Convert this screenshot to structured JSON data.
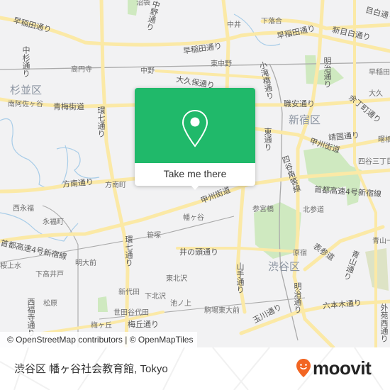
{
  "map": {
    "popup": {
      "cta_label": "Take me there",
      "accent_color": "#20b96a"
    },
    "attribution": "© OpenStreetMap contributors | © OpenMapTiles",
    "labels": {
      "wards": [
        "杉並区",
        "新宿区",
        "渋谷区"
      ],
      "roads": {
        "waseda_w": "早稲田通り",
        "waseda_c": "早稲田通り",
        "waseda_e": "早稲田通り",
        "shinmejiro": "新目白通り",
        "mejiro": "目白通り",
        "nakasugi": "中杉通り",
        "ome": "青梅街道",
        "kan7_n": "環七通り",
        "hounan": "方南通り",
        "koshu_w": "甲州街道",
        "koshu_e": "甲州街道",
        "okubo": "大久保通り",
        "kotakibashi": "小滝橋通り",
        "shokuan": "職安通り",
        "higashi": "東通り",
        "yotsuya_kaido": "四谷角筈線",
        "yasukuni": "靖国通り",
        "yocho": "余丁町通り",
        "meiji_n": "明治通り",
        "meiji_s": "明治通り",
        "shuto4": "首都高速4号新宿線",
        "shuto4_e": "首都高速4号新宿線",
        "kan7_s": "環七通り",
        "inokashira": "井の頭通り",
        "yamate": "山手通り",
        "omotesando": "表参道",
        "aoyama": "青山通り",
        "roppongi": "六本木通り",
        "tamagawa": "玉川通り",
        "umegaoka": "梅丘通り",
        "nishifukuji": "西福寺通り",
        "gaien": "外苑西通り",
        "nakano_dori": "中野通り"
      },
      "places": {
        "numabukuro": "沼袋",
        "nakai": "中井",
        "shimoochiai": "下落合",
        "waseda": "早稲田",
        "koenji": "高円寺",
        "nakano": "中野",
        "higashinakano": "東中野",
        "minamiasagaya": "南阿佐ヶ谷",
        "okubo": "大久",
        "akebonobashi": "曙橋",
        "yotsuya3": "四谷三丁目",
        "honancho": "方南町",
        "nishieifuku": "西永福",
        "eifukucho": "永福町",
        "sakurajosui": "桜上水",
        "meidaimae": "明大前",
        "shimotakaido": "下高井戸",
        "matsubara": "松原",
        "umegaoka": "梅ヶ丘",
        "shindaita": "新代田",
        "setagayadaita": "世田谷代田",
        "hatagaya": "幡ヶ谷",
        "sasazuka": "笹塚",
        "higashikitazawa": "東北沢",
        "shimokitazawa": "下北沢",
        "ikenoue": "池ノ上",
        "komabatodaimae": "駒場東大前",
        "sangubashi": "参宮橋",
        "kitasando": "北参道",
        "harajuku": "原宿",
        "aoyama1": "青山一",
        "nogata": "野方"
      }
    }
  },
  "footer": {
    "location_title": "渋谷区 幡ヶ谷社会教育館, Tokyo",
    "brand": "moovit",
    "brand_color": "#f26522"
  }
}
